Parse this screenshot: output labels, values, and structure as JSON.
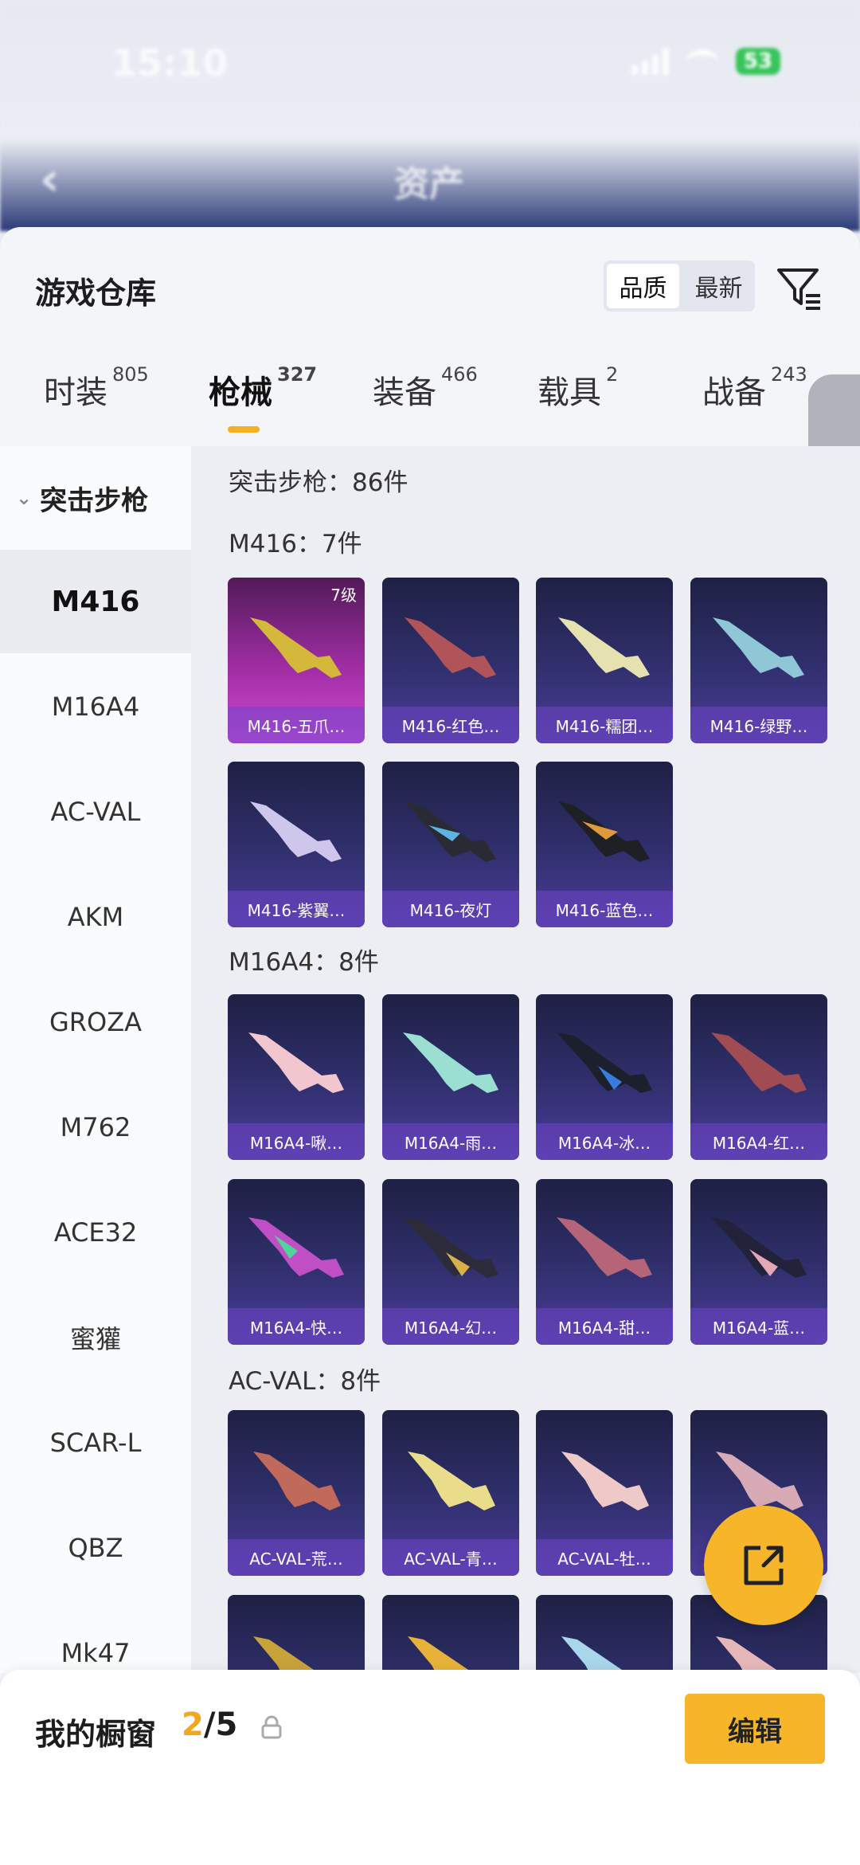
{
  "status_bar": {
    "time": "15:10",
    "battery": "53"
  },
  "top_nav": {
    "title": "资产"
  },
  "sheet": {
    "title": "游戏仓库",
    "sort": [
      "品质",
      "最新"
    ],
    "tabs": [
      {
        "label": "时装",
        "count": "805"
      },
      {
        "label": "枪械",
        "count": "327"
      },
      {
        "label": "装备",
        "count": "466"
      },
      {
        "label": "载具",
        "count": "2"
      },
      {
        "label": "战备",
        "count": "243"
      }
    ]
  },
  "sidebar": {
    "category": "突击步枪",
    "items": [
      "M416",
      "M16A4",
      "AC-VAL",
      "AKM",
      "GROZA",
      "M762",
      "ACE32",
      "蜜獾",
      "SCAR-L",
      "QBZ",
      "Mk47"
    ]
  },
  "content": {
    "category_title": "突击步枪：86件",
    "groups": [
      {
        "title": "M416：7件",
        "cards": [
          {
            "name": "M416-五爪…",
            "level": "7级"
          },
          {
            "name": "M416-红色…"
          },
          {
            "name": "M416-糯团…"
          },
          {
            "name": "M416-绿野…"
          },
          {
            "name": "M416-紫翼…"
          },
          {
            "name": "M416-夜灯"
          },
          {
            "name": "M416-蓝色…"
          }
        ]
      },
      {
        "title": "M16A4：8件",
        "cards": [
          {
            "name": "M16A4-啾…"
          },
          {
            "name": "M16A4-雨…"
          },
          {
            "name": "M16A4-冰…"
          },
          {
            "name": "M16A4-红…"
          },
          {
            "name": "M16A4-快…"
          },
          {
            "name": "M16A4-幻…"
          },
          {
            "name": "M16A4-甜…"
          },
          {
            "name": "M16A4-蓝…"
          }
        ]
      },
      {
        "title": "AC-VAL：8件",
        "cards": [
          {
            "name": "AC-VAL-荒…"
          },
          {
            "name": "AC-VAL-青…"
          },
          {
            "name": "AC-VAL-牡…"
          }
        ]
      }
    ]
  },
  "bottom_bar": {
    "label": "我的橱窗",
    "current": "2",
    "total": "/5",
    "edit_label": "编辑"
  },
  "colors": {
    "accent": "#f7b52a",
    "card_bg": "#2e2f6a",
    "card_rare": "#a12ea5"
  }
}
